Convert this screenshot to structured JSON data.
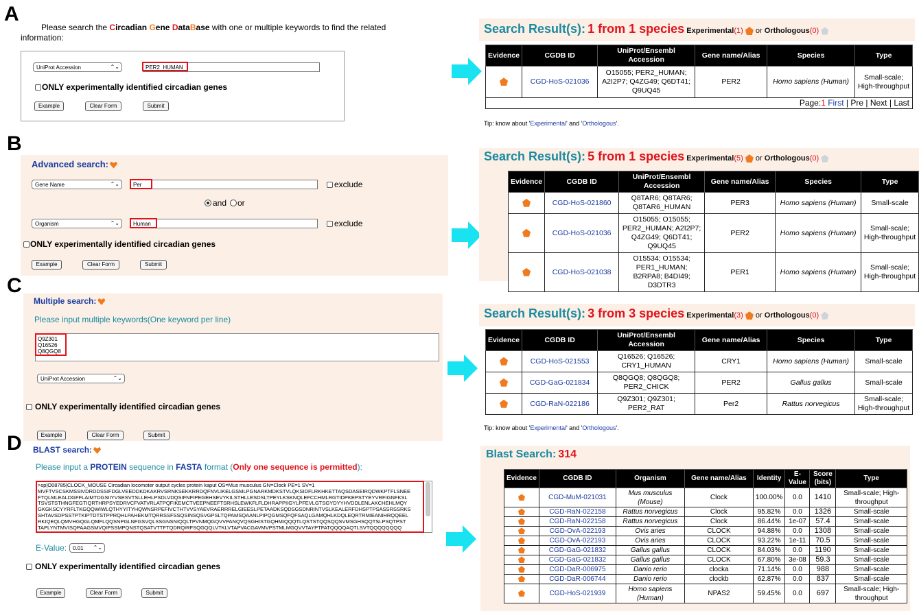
{
  "letters": {
    "a": "A",
    "b": "B",
    "c": "C",
    "d": "D"
  },
  "panel_a": {
    "intro_prefix": "Please search the",
    "db_c": "C",
    "db_ircadian": "ircadian",
    "db_g": "G",
    "db_ene": "ene",
    "db_d": "D",
    "db_ata": "ata",
    "db_b": "B",
    "db_ase": "ase",
    "intro_suffix": "with one or multiple keywords to find the related",
    "intro_line2": "information:",
    "field_select": "UniProt Accession",
    "field_value": "PER2_HUMAN",
    "only_label": "ONLY experimentally identified circadian genes",
    "example": "Example",
    "clear": "Clear Form",
    "submit": "Submit"
  },
  "panel_b": {
    "heading": "Advanced search:",
    "row1_select": "Gene Name",
    "row1_value": "Per",
    "exclude": "exclude",
    "and": "and",
    "or": "or",
    "row2_select": "Organism",
    "row2_value": "Human",
    "only_label": "ONLY experimentally identified circadian genes",
    "example": "Example",
    "clear": "Clear Form",
    "submit": "Submit"
  },
  "panel_c": {
    "heading": "Multiple search:",
    "instruction": "Please input multiple keywords(One keyword per line)",
    "keywords": [
      "Q9Z301",
      "Q16526",
      "Q8QGQ8"
    ],
    "select": "UniProt Accession",
    "only_label": "ONLY experimentally identified circadian genes",
    "example": "Example",
    "clear": "Clear Form",
    "submit": "Submit"
  },
  "panel_d": {
    "heading": "BLAST search:",
    "instr_1": "Please input a ",
    "instr_protein": "PROTEIN",
    "instr_2": " sequence in ",
    "instr_fasta": "FASTA",
    "instr_3": " format (",
    "instr_only": "Only one sequence is permitted",
    "instr_4": "):",
    "sequence": [
      ">sp|O08785|CLOCK_MOUSE Circadian locomoter output cycles protein kaput OS=Mus musculus GN=Clock PE=1 SV=1",
      "MVFTVSCSKMSSIVDRDDSSIFDGLVEEDDKDKAKRVSRNKSEKKRRDQFNVLIKELGSMLPGNARKMDKSTVLQKSIDFLRKHKETTAQSDASEIRQDWKPTFLSNEE",
      "FTQLMLEALDGFFLAIMTDGSIIYVSESVTSLLEHLPSDLVDQSIFNFIPEGEHSEVYKILSTHLLESDSLTPEYLKSKNQLEFCCHMLRGTIDPKEPSTYEYVRFIGNFKSL",
      "TSVSTSTHNGFEGTIQRTHRPSYEDRVCFVATVRLATPQFIKEMCTVEEPNEEFTSRHSLEWKFLFLDHRAPPIIGYLPFEVLGTSGYDYYHVDDLENLAKCHEHLMQY",
      "GKGKSCYYRFLTKGQQWIWLQTHYYITYHQWNSRPEFIVCTHTVVSYAEVRAERRRELGIEESLPETAADKSQDSGSDNRINTVSLKEALERFDHSPTPSASSRSSRKS",
      "SHTAVSDPSSTPTKIPTDTSTPPRQHLPAHEKMTQRRSSFSSQSINSQSVGPSLTQPAMSQAANLPIPQGMSQFQFSAQLGAMQHLKDQLEQRTRMIEANIHRQQEEL",
      "RKIQEQLQMVHGQGLQMFLQQSNPGLNFGSVQLSSGNSNIQQLTPVNMQGQVVPANQVQSGHISTGQHMIQQQTLQSTSTQQSQQSVMSGHSQQTSLPSQTPST",
      "TAPLYNTMVISQPAAGSMVQIPSSMPQNSTQSATVTTFTQDRQIRFSQGQQLVTKLVTAPVACGAVMVPSTMLMGQVVTAYPTFATQQQQAQTLSVTQQQQQQQQ"
    ],
    "evalue_label": "E-Value:",
    "evalue_value": "0.01",
    "only_label": "ONLY experimentally identified circadian genes",
    "example": "Example",
    "clear": "Clear Form",
    "submit": "Submit"
  },
  "result_a": {
    "title": "Search Result(s):",
    "count": "1 from 1 species",
    "experimental": "Experimental",
    "exp_count": "(1)",
    "or": "or",
    "orthologous": "Orthologous",
    "orth_count": "(0)",
    "headers": [
      "Evidence",
      "CGDB ID",
      "UniProt/Ensembl Accession",
      "Gene name/Alias",
      "Species",
      "Type"
    ],
    "rows": [
      [
        "",
        "CGD-HoS-021036",
        "O15055; PER2_HUMAN; A2I2P7; Q4ZG49; Q6DT41; Q9UQ45",
        "PER2",
        "Homo sapiens (Human)",
        "Small-scale; High-throughput"
      ]
    ],
    "page_label": "Page:",
    "page_num": "1",
    "first": "First",
    "pre": "Pre",
    "next": "Next",
    "last": "Last",
    "tip_prefix": "Tip: know about '",
    "tip_exp": "Experimental",
    "tip_mid": "' and '",
    "tip_orth": "Orthologous",
    "tip_suffix": "'."
  },
  "result_b": {
    "title": "Search Result(s):",
    "count": "5 from 1 species",
    "experimental": "Experimental",
    "exp_count": "(5)",
    "or": "or",
    "orthologous": "Orthologous",
    "orth_count": "(0)",
    "headers": [
      "Evidence",
      "CGDB ID",
      "UniProt/Ensembl Accession",
      "Gene name/Alias",
      "Species",
      "Type"
    ],
    "rows": [
      [
        "",
        "CGD-HoS-021860",
        "Q8TAR6; Q8TAR6; Q8TAR6_HUMAN",
        "PER3",
        "Homo sapiens (Human)",
        "Small-scale"
      ],
      [
        "",
        "CGD-HoS-021036",
        "O15055; O15055; PER2_HUMAN; A2I2P7; Q4ZG49; Q6DT41; Q9UQ45",
        "PER2",
        "Homo sapiens (Human)",
        "Small-scale; High-throughput"
      ],
      [
        "",
        "CGD-HoS-021038",
        "O15534; O15534; PER1_HUMAN; B2RPA8; B4DI49; D3DTR3",
        "PER1",
        "Homo sapiens (Human)",
        "Small-scale; High-throughput"
      ]
    ]
  },
  "result_c": {
    "title": "Search Result(s):",
    "count": "3 from 3 species",
    "experimental": "Experimental",
    "exp_count": "(3)",
    "or": "or",
    "orthologous": "Orthologous",
    "orth_count": "(0)",
    "headers": [
      "Evidence",
      "CGDB ID",
      "UniProt/Ensembl Accession",
      "Gene name/Alias",
      "Species",
      "Type"
    ],
    "rows": [
      [
        "",
        "CGD-HoS-021553",
        "Q16526; Q16526; CRY1_HUMAN",
        "CRY1",
        "Homo sapiens (Human)",
        "Small-scale"
      ],
      [
        "",
        "CGD-GaG-021834",
        "Q8QGQ8; Q8QGQ8; PER2_CHICK",
        "PER2",
        "Gallus gallus",
        "Small-scale"
      ],
      [
        "",
        "CGD-RaN-022186",
        "Q9Z301; Q9Z301; PER2_RAT",
        "Per2",
        "Rattus norvegicus",
        "Small-scale; High-throughput"
      ]
    ],
    "tip_prefix": "Tip: know about '",
    "tip_exp": "Experimental",
    "tip_mid": "' and '",
    "tip_orth": "Orthologous",
    "tip_suffix": "'."
  },
  "result_d": {
    "title": "Blast Search:",
    "count": "314",
    "headers": [
      "Evidence",
      "CGDB ID",
      "Organism",
      "Gene name/Alias",
      "Identity",
      "E-Value",
      "Score (bits)",
      "Type"
    ],
    "rows": [
      [
        "",
        "CGD-MuM-021031",
        "Mus musculus (Mouse)",
        "Clock",
        "100.00%",
        "0.0",
        "1410",
        "Small-scale; High-throughput"
      ],
      [
        "",
        "CGD-RaN-022158",
        "Rattus norvegicus",
        "Clock",
        "95.82%",
        "0.0",
        "1326",
        "Small-scale"
      ],
      [
        "",
        "CGD-RaN-022158",
        "Rattus norvegicus",
        "Clock",
        "86.44%",
        "1e-07",
        "57.4",
        "Small-scale"
      ],
      [
        "",
        "CGD-OvA-022193",
        "Ovis aries",
        "CLOCK",
        "94.88%",
        "0.0",
        "1308",
        "Small-scale"
      ],
      [
        "",
        "CGD-OvA-022193",
        "Ovis aries",
        "CLOCK",
        "93.22%",
        "1e-11",
        "70.5",
        "Small-scale"
      ],
      [
        "",
        "CGD-GaG-021832",
        "Gallus gallus",
        "CLOCK",
        "84.03%",
        "0.0",
        "1190",
        "Small-scale"
      ],
      [
        "",
        "CGD-GaG-021832",
        "Gallus gallus",
        "CLOCK",
        "67.80%",
        "3e-08",
        "59.3",
        "Small-scale"
      ],
      [
        "",
        "CGD-DaR-006975",
        "Danio rerio",
        "clocka",
        "71.14%",
        "0.0",
        "988",
        "Small-scale"
      ],
      [
        "",
        "CGD-DaR-006744",
        "Danio rerio",
        "clockb",
        "62.87%",
        "0.0",
        "837",
        "Small-scale"
      ],
      [
        "",
        "CGD-HoS-021939",
        "Homo sapiens (Human)",
        "NPAS2",
        "59.45%",
        "0.0",
        "697",
        "Small-scale; High-throughput"
      ]
    ]
  },
  "colors": {
    "accent_red": "#e0121b",
    "teal": "#1a8aa0",
    "cyan_arrow": "#19e3f0",
    "evidence_orange": "#f07b1e",
    "beige": "#fbefe6",
    "link_blue": "#1a3ba0"
  },
  "icons": {
    "arrow": "cyan-right-arrow-icon",
    "evidence": "orange-pentagon-icon",
    "ortholog": "gray-pentagon-icon",
    "heading": "orange-heart-icon"
  }
}
